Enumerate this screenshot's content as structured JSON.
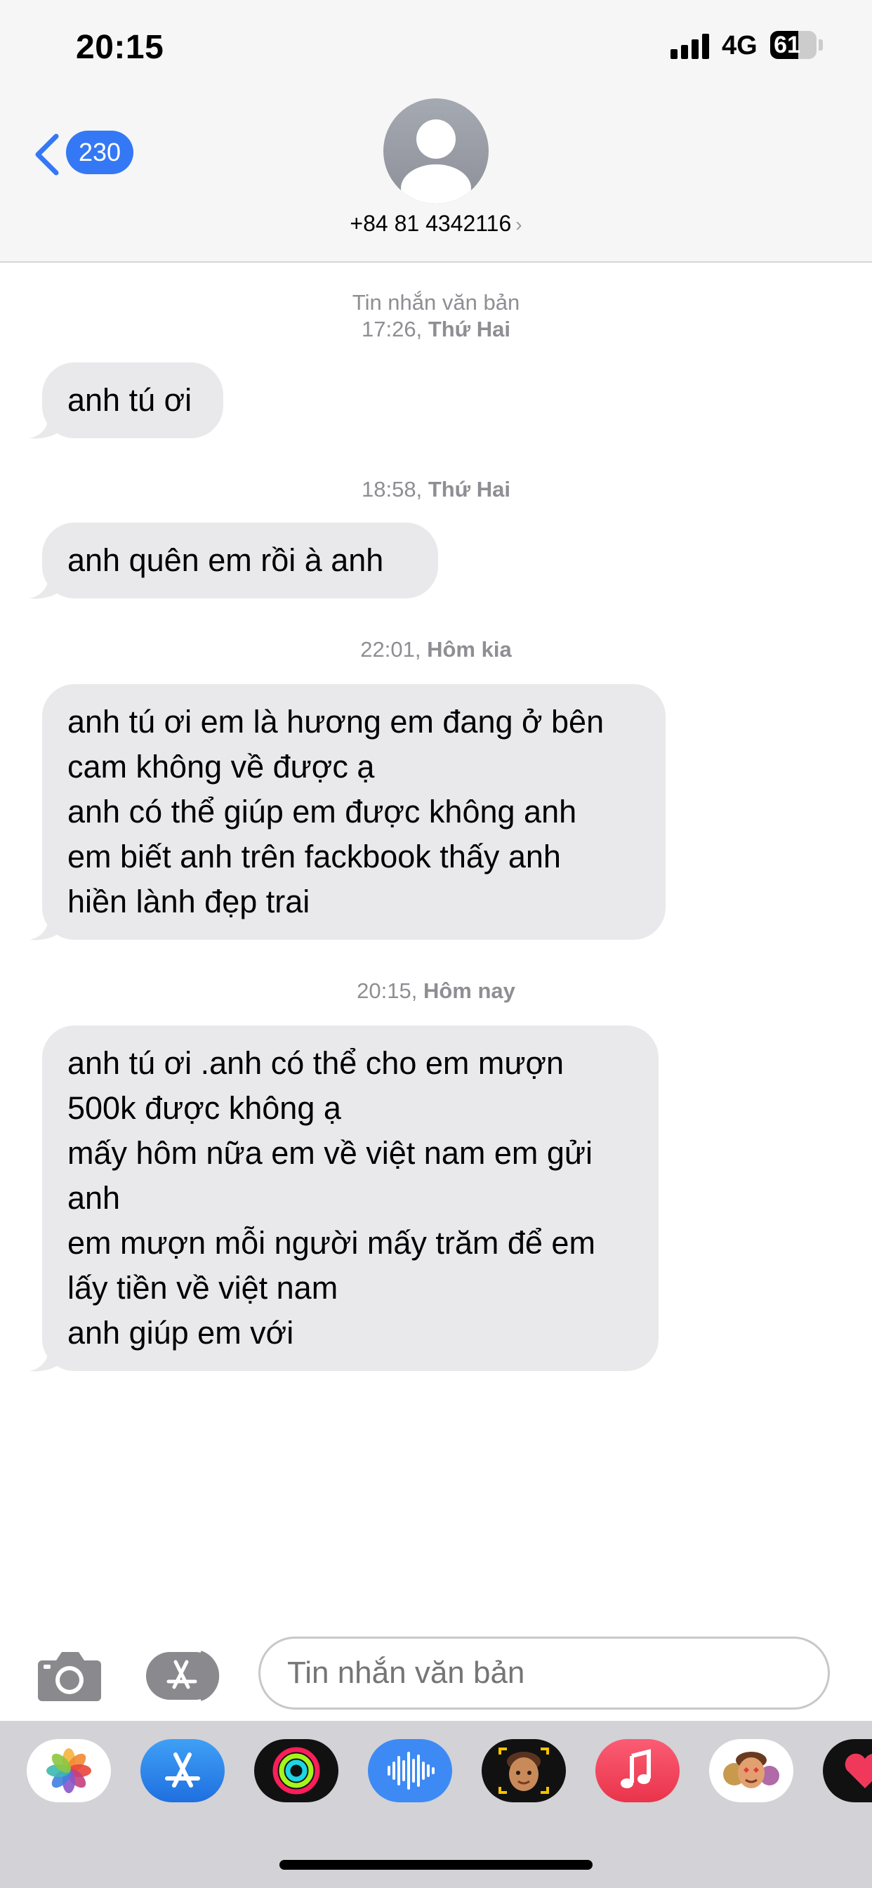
{
  "status_bar": {
    "time": "20:15",
    "network": "4G",
    "battery": "61"
  },
  "header": {
    "back_count": "230",
    "contact": "+84 81 4342116",
    "contact_chevron": "›"
  },
  "messages": [
    {
      "timestamp_prefix": "Tin nhắn văn bản",
      "timestamp_time": "17:26,",
      "timestamp_day": "Thứ Hai",
      "text": "anh tú ơi"
    },
    {
      "timestamp_time": "18:58,",
      "timestamp_day": "Thứ Hai",
      "text": "anh quên em rồi à anh"
    },
    {
      "timestamp_time": "22:01,",
      "timestamp_day": "Hôm kia",
      "text": "anh tú ơi em là hương em đang ở bên\ncam không về được ạ\nanh có thể giúp em được không anh\nem biết anh trên fackbook thấy anh\nhiền lành đẹp trai"
    },
    {
      "timestamp_time": "20:15,",
      "timestamp_day": "Hôm nay",
      "text": "anh tú ơi .anh có thể cho em mượn\n500k được không ạ\nmấy hôm nữa em về việt nam em gửi\nanh\nem mượn mỗi người mấy trăm để em\nlấy tiền về việt nam\nanh giúp em với"
    }
  ],
  "input": {
    "placeholder": "Tin nhắn văn bản"
  },
  "icons": {
    "back": "chevron-left-icon",
    "avatar": "person-icon",
    "camera": "camera-icon",
    "apps": "app-store-icon",
    "drawer": [
      "photos-icon",
      "app-store-icon",
      "activity-icon",
      "audio-message-icon",
      "memoji-icon",
      "music-icon",
      "memoji-stickers-icon",
      "digital-touch-icon"
    ]
  },
  "colors": {
    "accent": "#3478f6",
    "bubble": "#e9e9eb",
    "timestamp": "#8e8e93",
    "drawer": "#d2d2d7"
  }
}
